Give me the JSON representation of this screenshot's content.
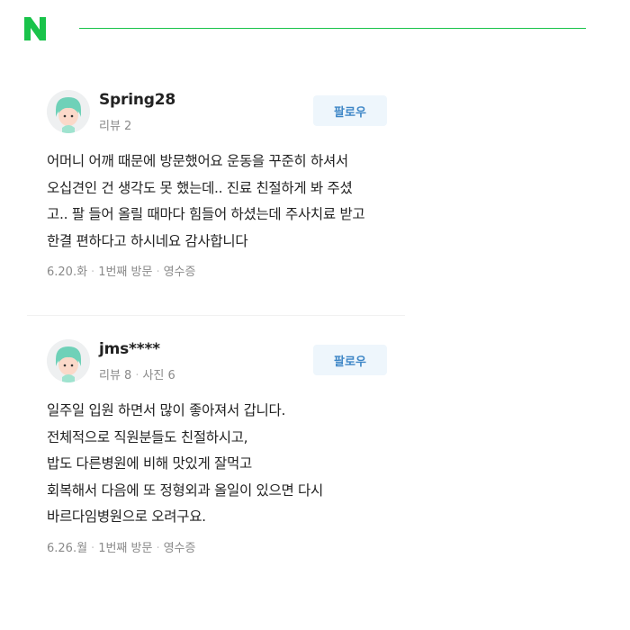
{
  "header": {
    "logo_letter": "N",
    "accent_color": "#19c34a"
  },
  "reviews": [
    {
      "username": "Spring28",
      "meta": [
        "리뷰 2"
      ],
      "follow_label": "팔로우",
      "body_lines": [
        "어머니 어깨 때문에 방문했어요 운동을 꾸준히 하셔서",
        "오십견인 건 생각도 못 했는데.. 진료 친절하게 봐 주셨",
        "고.. 팔 들어 올릴 때마다 힘들어 하셨는데 주사치료 받고",
        "한결 편하다고 하시네요 감사합니다"
      ],
      "footer": [
        "6.20.화",
        "1번째 방문",
        "영수증"
      ]
    },
    {
      "username": "jms****",
      "meta": [
        "리뷰 8",
        "사진 6"
      ],
      "follow_label": "팔로우",
      "body_lines": [
        "일주일 입원 하면서 많이 좋아져서 갑니다.",
        "전체적으로 직원분들도 친절하시고,",
        "밥도 다른병원에 비해 맛있게 잘먹고",
        "회복해서 다음에 또 정형외과 올일이 있으면 다시",
        "바르다임병원으로 오려구요."
      ],
      "footer": [
        "6.26.월",
        "1번째 방문",
        "영수증"
      ]
    }
  ]
}
